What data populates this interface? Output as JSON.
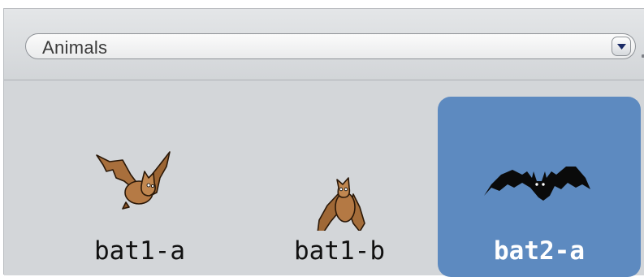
{
  "category_select": {
    "value": "Animals"
  },
  "sprites": [
    {
      "label": "bat1-a",
      "selected": false,
      "icon": "bat-brown-flying-icon"
    },
    {
      "label": "bat1-b",
      "selected": false,
      "icon": "bat-brown-hanging-icon"
    },
    {
      "label": "bat2-a",
      "selected": true,
      "icon": "bat-black-icon"
    }
  ],
  "colors": {
    "selection": "#5d8ac0",
    "panel": "#d3d6d9",
    "bat_brown": "#a8703e",
    "bat_black": "#0a0a0a"
  }
}
